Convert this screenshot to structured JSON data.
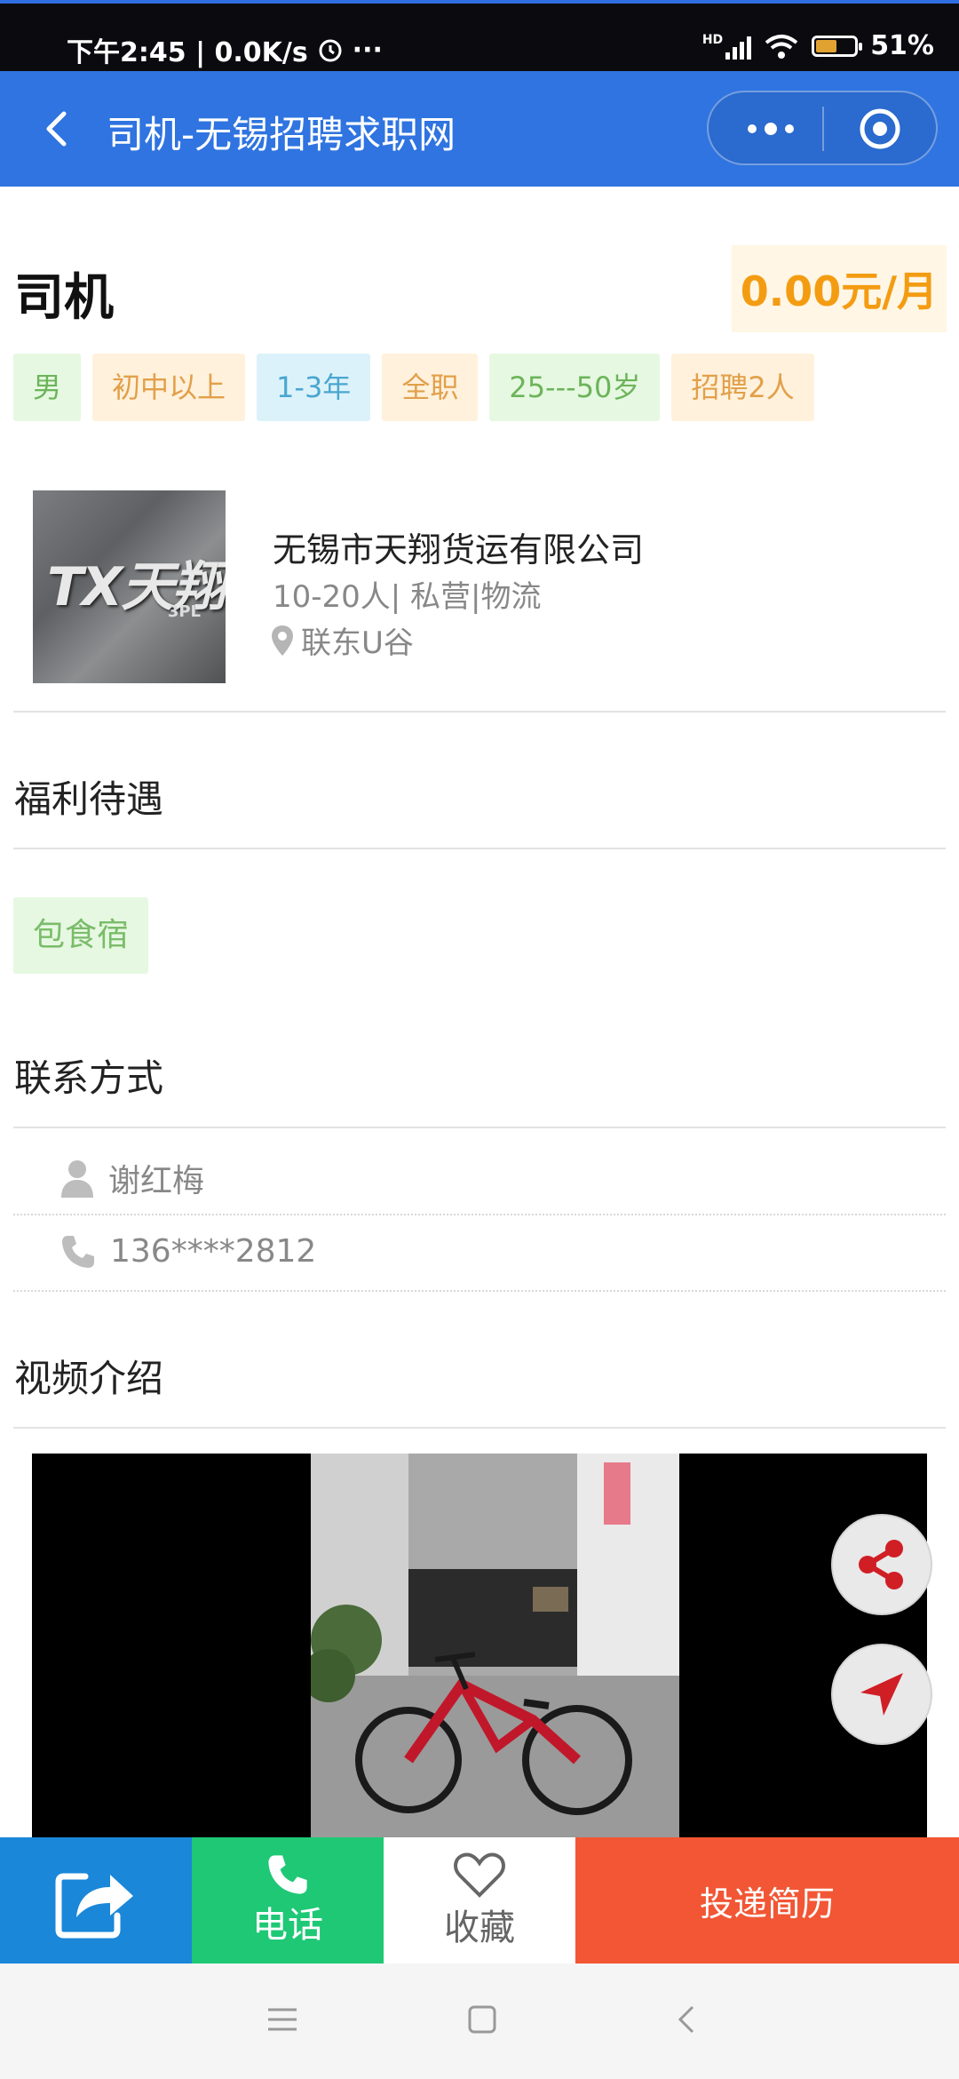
{
  "status": {
    "time_speed": "下午2:45 | 0.0K/s",
    "more": "···",
    "network": "HD",
    "battery": "51%",
    "battery_level": 0.51
  },
  "nav": {
    "title": "司机-无锡招聘求职网"
  },
  "job": {
    "title": "司机",
    "salary": "0.00元/月",
    "tags": [
      "男",
      "初中以上",
      "1-3年",
      "全职",
      "25---50岁",
      "招聘2人"
    ]
  },
  "company": {
    "logo_text": "TX天翔",
    "logo_sub": "3PL",
    "name": "无锡市天翔货运有限公司",
    "info": "10-20人| 私营|物流",
    "location": "联东U谷"
  },
  "benefits": {
    "title": "福利待遇",
    "items": [
      "包食宿"
    ]
  },
  "contact": {
    "title": "联系方式",
    "person": "谢红梅",
    "phone": "136****2812"
  },
  "video": {
    "title": "视频介绍"
  },
  "bottom": {
    "call": "电话",
    "favorite": "收藏",
    "apply": "投递简历"
  },
  "colors": {
    "nav": "#2f74e0",
    "salary": "#f39c12",
    "call": "#1fc875",
    "apply": "#f25634",
    "share": "#1a87d9"
  }
}
